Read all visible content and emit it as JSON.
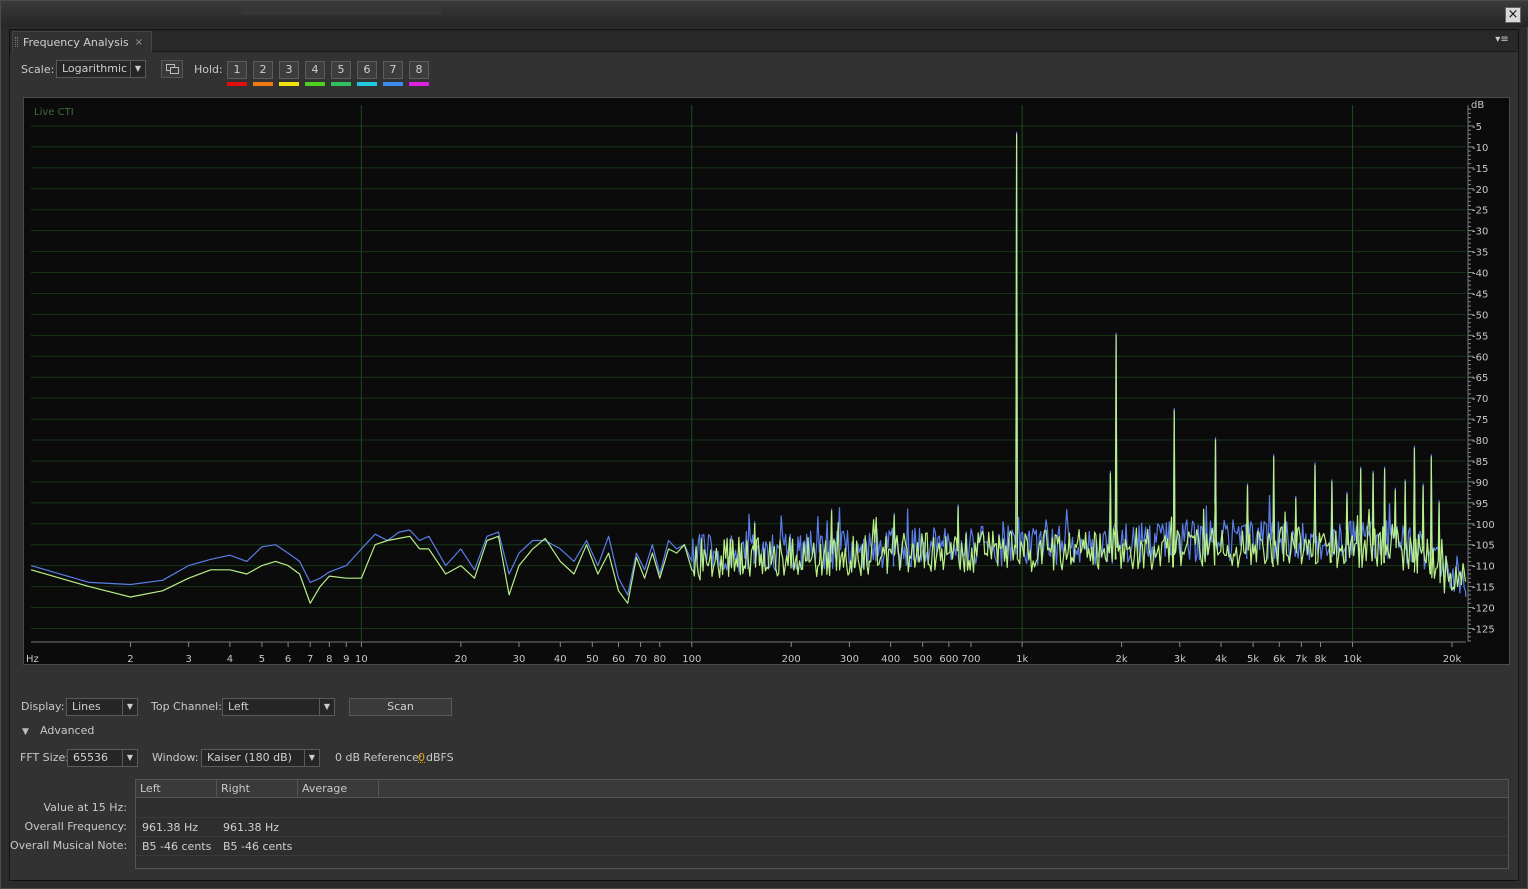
{
  "panel": {
    "tab_title": "Frequency Analysis",
    "tab_close": "×",
    "menu_glyph": "▾≡"
  },
  "window": {
    "close_glyph": "×"
  },
  "toolbar": {
    "scale_label": "Scale:",
    "scale_value": "Logarithmic",
    "hold_label": "Hold:",
    "hold_buttons": [
      "1",
      "2",
      "3",
      "4",
      "5",
      "6",
      "7",
      "8"
    ],
    "hold_colors": [
      "#e01010",
      "#f07a10",
      "#f0e010",
      "#50d020",
      "#30c060",
      "#20c8e0",
      "#3c8cf0",
      "#e020e0"
    ]
  },
  "graph": {
    "overlay_label": "Live CTI",
    "x_unit": "Hz",
    "y_unit": "dB",
    "series_colors": [
      "#5a7ee8",
      "#b8f088"
    ]
  },
  "chart_data": {
    "type": "line",
    "x_scale": "log",
    "xlim": [
      1,
      22050
    ],
    "ylim": [
      -128,
      0
    ],
    "xlabel": "Hz",
    "ylabel": "dB",
    "x_ticks": [
      {
        "v": 2,
        "label": "2"
      },
      {
        "v": 3,
        "label": "3"
      },
      {
        "v": 4,
        "label": "4"
      },
      {
        "v": 5,
        "label": "5"
      },
      {
        "v": 6,
        "label": "6"
      },
      {
        "v": 7,
        "label": "7"
      },
      {
        "v": 8,
        "label": "8"
      },
      {
        "v": 9,
        "label": "9"
      },
      {
        "v": 10,
        "label": "10"
      },
      {
        "v": 20,
        "label": "20"
      },
      {
        "v": 30,
        "label": "30"
      },
      {
        "v": 40,
        "label": "40"
      },
      {
        "v": 50,
        "label": "50"
      },
      {
        "v": 60,
        "label": "60"
      },
      {
        "v": 70,
        "label": "70"
      },
      {
        "v": 80,
        "label": "80"
      },
      {
        "v": 100,
        "label": "100"
      },
      {
        "v": 200,
        "label": "200"
      },
      {
        "v": 300,
        "label": "300"
      },
      {
        "v": 400,
        "label": "400"
      },
      {
        "v": 500,
        "label": "500"
      },
      {
        "v": 600,
        "label": "600"
      },
      {
        "v": 700,
        "label": "700"
      },
      {
        "v": 1000,
        "label": "1k"
      },
      {
        "v": 2000,
        "label": "2k"
      },
      {
        "v": 3000,
        "label": "3k"
      },
      {
        "v": 4000,
        "label": "4k"
      },
      {
        "v": 5000,
        "label": "5k"
      },
      {
        "v": 6000,
        "label": "6k"
      },
      {
        "v": 7000,
        "label": "7k"
      },
      {
        "v": 8000,
        "label": "8k"
      },
      {
        "v": 10000,
        "label": "10k"
      },
      {
        "v": 20000,
        "label": "20k"
      }
    ],
    "y_ticks": [
      -5,
      -10,
      -15,
      -20,
      -25,
      -30,
      -35,
      -40,
      -45,
      -50,
      -55,
      -60,
      -65,
      -70,
      -75,
      -80,
      -85,
      -90,
      -95,
      -100,
      -105,
      -110,
      -115,
      -120,
      -125
    ],
    "series": [
      {
        "color": "#5a7ee8",
        "x": [
          1,
          1.5,
          2,
          2.5,
          3,
          3.5,
          4,
          4.5,
          5,
          5.5,
          6,
          6.5,
          7,
          7.5,
          8,
          9,
          10,
          11,
          12,
          13,
          14,
          15,
          16,
          18,
          20,
          22,
          24,
          26,
          28,
          30,
          33,
          36,
          40,
          44,
          48,
          52,
          56,
          60,
          64,
          68,
          72,
          76,
          80,
          85,
          90,
          95,
          100
        ],
        "y": [
          -110,
          -114,
          -114.5,
          -113.5,
          -110,
          -108.5,
          -107.5,
          -109,
          -105.5,
          -105,
          -107,
          -109,
          -114,
          -113,
          -111.5,
          -110,
          -106,
          -102.5,
          -104,
          -102,
          -101.5,
          -104,
          -103,
          -110,
          -106,
          -111,
          -103,
          -102,
          -112,
          -107,
          -104,
          -104,
          -106,
          -109,
          -104,
          -110,
          -103,
          -113,
          -117,
          -107,
          -111,
          -105,
          -112,
          -104,
          -106,
          -105,
          -109
        ]
      },
      {
        "color": "#b8f088",
        "x": [
          1,
          1.5,
          2,
          2.5,
          3,
          3.5,
          4,
          4.5,
          5,
          5.5,
          6,
          6.5,
          7,
          7.5,
          8,
          9,
          10,
          11,
          12,
          13,
          14,
          15,
          16,
          18,
          20,
          22,
          24,
          26,
          28,
          30,
          33,
          36,
          40,
          44,
          48,
          52,
          56,
          60,
          64,
          68,
          72,
          76,
          80,
          85,
          90,
          95,
          100
        ],
        "y": [
          -111,
          -115,
          -117.5,
          -116,
          -113,
          -111,
          -111,
          -112,
          -110,
          -109,
          -110,
          -112,
          -119,
          -115,
          -112.5,
          -113,
          -113,
          -105,
          -104,
          -103.5,
          -103,
          -106,
          -106,
          -112,
          -110,
          -113,
          -104,
          -103,
          -117,
          -110,
          -106,
          -103.5,
          -109,
          -112,
          -105,
          -112,
          -107,
          -116,
          -119,
          -108,
          -113,
          -107,
          -113,
          -106,
          -107,
          -105,
          -111
        ]
      }
    ],
    "noise_floor": {
      "x": [
        100,
        1000,
        5000,
        12000,
        17000,
        19000,
        22050
      ],
      "y": [
        -107,
        -105,
        -104,
        -104,
        -106,
        -111,
        -113
      ]
    },
    "peaks": [
      {
        "x": 962,
        "y": -7
      },
      {
        "x": 1924,
        "y": -55
      },
      {
        "x": 1850,
        "y": -88
      },
      {
        "x": 2886,
        "y": -73
      },
      {
        "x": 3848,
        "y": -80
      },
      {
        "x": 4810,
        "y": -91
      },
      {
        "x": 5772,
        "y": -84
      },
      {
        "x": 6734,
        "y": -94
      },
      {
        "x": 7696,
        "y": -86
      },
      {
        "x": 8658,
        "y": -90
      },
      {
        "x": 9620,
        "y": -93
      },
      {
        "x": 10582,
        "y": -87
      },
      {
        "x": 11544,
        "y": -88
      },
      {
        "x": 12506,
        "y": -87
      },
      {
        "x": 13468,
        "y": -92
      },
      {
        "x": 14430,
        "y": -90
      },
      {
        "x": 15392,
        "y": -82
      },
      {
        "x": 16354,
        "y": -91
      },
      {
        "x": 17316,
        "y": -84
      },
      {
        "x": 18278,
        "y": -95
      },
      {
        "x": 640,
        "y": -96
      },
      {
        "x": 410,
        "y": -98
      },
      {
        "x": 265,
        "y": -97
      },
      {
        "x": 155,
        "y": -100
      }
    ]
  },
  "controls": {
    "display_label": "Display:",
    "display_value": "Lines",
    "top_channel_label": "Top Channel:",
    "top_channel_value": "Left",
    "scan_label": "Scan",
    "advanced_label": "Advanced",
    "advanced_glyph": "▼",
    "fft_label": "FFT Size:",
    "fft_value": "65536",
    "window_label": "Window:",
    "window_value": "Kaiser (180 dB)",
    "ref_label": "0 dB Reference:",
    "ref_value": "0",
    "ref_unit": "dBFS",
    "arrow_glyph": "▼"
  },
  "table": {
    "columns": [
      "Left",
      "Right",
      "Average"
    ],
    "rows": [
      {
        "label": "Value at 15 Hz:",
        "left": "",
        "right": "",
        "average": ""
      },
      {
        "label": "Overall Frequency:",
        "left": "961.38 Hz",
        "right": "961.38 Hz",
        "average": ""
      },
      {
        "label": "Overall Musical Note:",
        "left": "B5 -46 cents",
        "right": "B5 -46 cents",
        "average": ""
      }
    ]
  }
}
